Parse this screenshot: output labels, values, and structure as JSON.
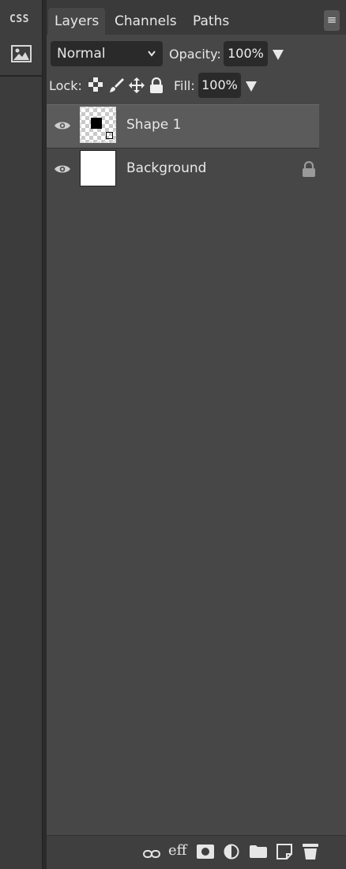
{
  "sidebar": {
    "css_label": "CSS",
    "icons": [
      "css-icon",
      "image-icon"
    ]
  },
  "panel": {
    "tabs": [
      {
        "label": "Layers",
        "active": true
      },
      {
        "label": "Channels",
        "active": false
      },
      {
        "label": "Paths",
        "active": false
      }
    ],
    "menu_icon": "hamburger-icon",
    "blend_mode": "Normal",
    "opacity_label": "Opacity:",
    "opacity_value": "100%",
    "lock_label": "Lock:",
    "lock_icons": [
      "lock-transparency-icon",
      "lock-paint-icon",
      "lock-move-icon",
      "lock-all-icon"
    ],
    "fill_label": "Fill:",
    "fill_value": "100%",
    "layers": [
      {
        "name": "Shape 1",
        "visible": true,
        "selected": true,
        "locked": false,
        "thumbnail": "shape"
      },
      {
        "name": "Background",
        "visible": true,
        "selected": false,
        "locked": true,
        "thumbnail": "white"
      }
    ],
    "bottom_icons": [
      "link-icon",
      "effects-icon",
      "mask-icon",
      "adjustment-icon",
      "folder-icon",
      "new-layer-icon",
      "trash-icon"
    ],
    "effects_label": "eff"
  },
  "colors": {
    "panel_bg": "#474747",
    "selected_row": "#5b5b5b",
    "field_bg": "#2a2a2a"
  }
}
